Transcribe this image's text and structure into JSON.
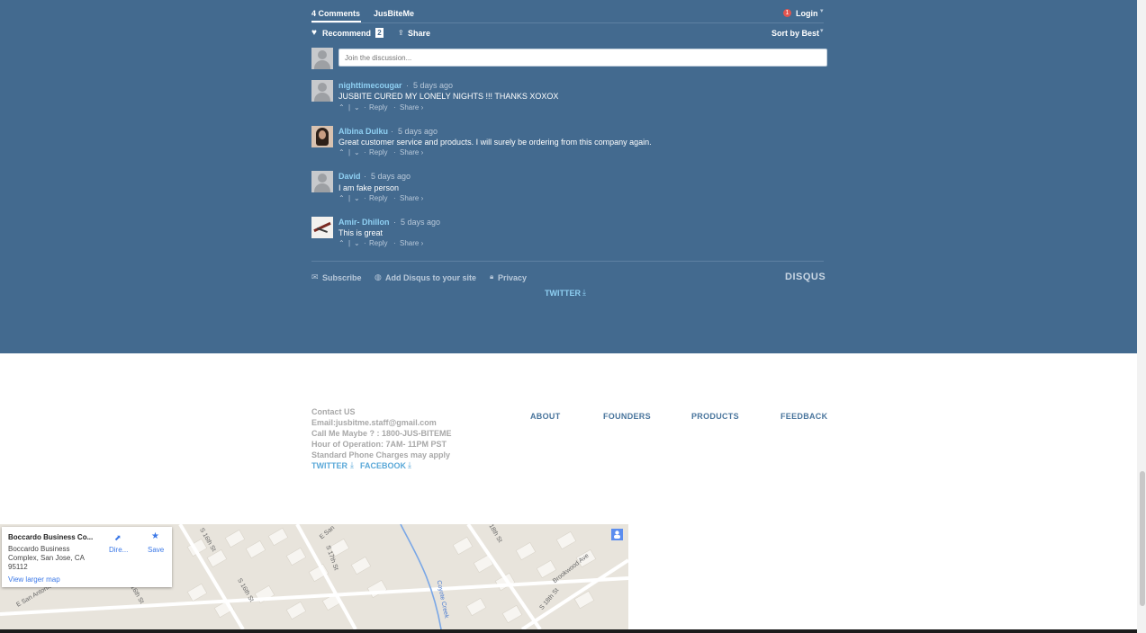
{
  "disqus": {
    "comments_count_label": "4 Comments",
    "community_label": "JusBiteMe",
    "notification_count": "1",
    "login_label": "Login",
    "recommend_label": "Recommend",
    "recommend_count": "2",
    "share_label": "Share",
    "sort_label": "Sort by Best",
    "input_placeholder": "Join the discussion...",
    "comments": [
      {
        "author": "nighttimecougar",
        "time": "5 days ago",
        "text": "JUSBITE CURED MY LONELY NIGHTS !!! THANKS XOXOX",
        "reply": "Reply",
        "share": "Share ›"
      },
      {
        "author": "Albina Dulku",
        "time": "5 days ago",
        "text": "Great customer service and products. I will surely be ordering from this company again.",
        "reply": "Reply",
        "share": "Share ›"
      },
      {
        "author": "David",
        "time": "5 days ago",
        "text": "I am fake person",
        "reply": "Reply",
        "share": "Share ›"
      },
      {
        "author": "Amir- Dhillon",
        "time": "5 days ago",
        "text": "This is great",
        "reply": "Reply",
        "share": "Share ›"
      }
    ],
    "footer": {
      "subscribe_label": "Subscribe",
      "add_disqus_label": "Add Disqus to your site",
      "privacy_label": "Privacy",
      "brand": "DISQUS"
    },
    "twitter_label": "TWITTER"
  },
  "site_footer": {
    "contact_title": "Contact US",
    "email": "Email:jusbitme.staff@gmail.com",
    "phone": "Call Me Maybe ? : 1800-JUS-BITEME",
    "hours": "Hour of Operation: 7AM- 11PM PST",
    "charges": "Standard Phone Charges may apply",
    "twitter": "TWITTER",
    "facebook": "FACEBOOK",
    "nav": [
      "ABOUT",
      "FOUNDERS",
      "PRODUCTS",
      "FEEDBACK"
    ]
  },
  "map": {
    "place_title": "Boccardo Business Co...",
    "address_line1": "Boccardo Business",
    "address_line2": "Complex, San Jose, CA",
    "address_line3": "95112",
    "larger_map": "View larger map",
    "directions_label": "Dire...",
    "save_label": "Save",
    "streets": [
      "S 16th St",
      "E San",
      "S 17th St",
      "S 16th St",
      "E San Antonio",
      "Coyote Creek",
      "S 18th St",
      "Brookwood Ave",
      "S 18th St",
      "S 16th St"
    ]
  },
  "colors": {
    "section_bg": "#436a8f",
    "accent": "#8fd0f3",
    "nav": "#48749c"
  }
}
